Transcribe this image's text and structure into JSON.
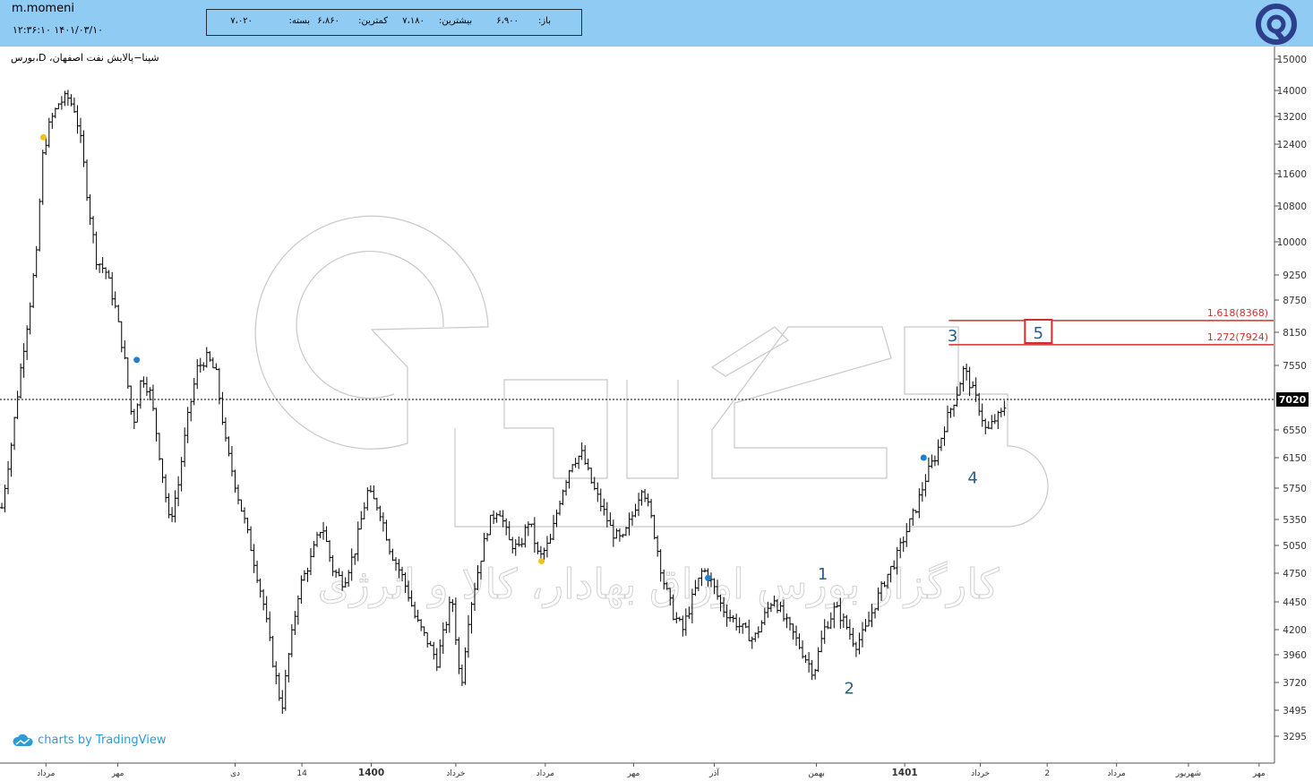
{
  "header": {
    "username": "m.momeni",
    "datetime": "۱۴۰۱/۰۳/۱۰ ۱۲:۳۶:۱۰",
    "quote": {
      "open_label": "باز:",
      "open_value": "۶،۹۰۰",
      "high_label": "بیشترین:",
      "high_value": "۷،۱۸۰",
      "low_label": "کمترین:",
      "low_value": "۶،۸۶۰",
      "close_label": "بسته:",
      "close_value": "۷،۰۲۰"
    },
    "logo_icon": "broker-logo-icon"
  },
  "chart_title": "بورس،D ،شپنا−پالایش نفت اصفهان",
  "watermark_text": "کارگزار بورس اوراق بهادار، کالا و انرژی",
  "attribution": "charts by TradingView",
  "colors": {
    "header": "#90cbf4",
    "bars": "#000000",
    "fib_line": "#d32f2f",
    "wave_label": "#2a5d8c",
    "marker_yellow": "#f2c21b",
    "marker_blue": "#1f7fd1"
  },
  "chart_data": {
    "type": "ohlc",
    "ylim": [
      3100,
      15600
    ],
    "y_ticks": [
      15000,
      14000,
      13200,
      12400,
      11600,
      10800,
      10000,
      9250,
      8750,
      8150,
      7550,
      6550,
      6150,
      5750,
      5350,
      5050,
      4750,
      4450,
      4200,
      3960,
      3720,
      3495,
      3295
    ],
    "last_price": 7020,
    "last_price_label": "7020",
    "x_ticks": [
      {
        "label": "مرداد",
        "pos": 0.035
      },
      {
        "label": "مهر",
        "pos": 0.092
      },
      {
        "label": "دی",
        "pos": 0.185
      },
      {
        "label": "14",
        "pos": 0.238
      },
      {
        "label": "1400",
        "pos": 0.293
      },
      {
        "label": "خرداد",
        "pos": 0.36
      },
      {
        "label": "مرداد",
        "pos": 0.431
      },
      {
        "label": "مهر",
        "pos": 0.501
      },
      {
        "label": "آذر",
        "pos": 0.565
      },
      {
        "label": "بهمن",
        "pos": 0.646
      },
      {
        "label": "1401",
        "pos": 0.716
      },
      {
        "label": "خرداد",
        "pos": 0.776
      },
      {
        "label": "2",
        "pos": 0.829
      },
      {
        "label": "مرداد",
        "pos": 0.884
      },
      {
        "label": "شهریور",
        "pos": 0.941
      },
      {
        "label": "مهر",
        "pos": 0.997
      }
    ],
    "price_path": [
      [
        0.0,
        5500
      ],
      [
        0.008,
        6400
      ],
      [
        0.015,
        7500
      ],
      [
        0.022,
        8600
      ],
      [
        0.028,
        9800
      ],
      [
        0.032,
        12000
      ],
      [
        0.038,
        13000
      ],
      [
        0.045,
        13600
      ],
      [
        0.052,
        13800
      ],
      [
        0.058,
        13400
      ],
      [
        0.063,
        12400
      ],
      [
        0.068,
        11000
      ],
      [
        0.075,
        9600
      ],
      [
        0.083,
        9300
      ],
      [
        0.09,
        8600
      ],
      [
        0.097,
        7700
      ],
      [
        0.104,
        6600
      ],
      [
        0.111,
        7400
      ],
      [
        0.118,
        7100
      ],
      [
        0.125,
        6200
      ],
      [
        0.133,
        5300
      ],
      [
        0.14,
        5800
      ],
      [
        0.148,
        6800
      ],
      [
        0.155,
        7500
      ],
      [
        0.163,
        7700
      ],
      [
        0.17,
        7400
      ],
      [
        0.178,
        6300
      ],
      [
        0.188,
        5600
      ],
      [
        0.198,
        5000
      ],
      [
        0.208,
        4400
      ],
      [
        0.215,
        3900
      ],
      [
        0.222,
        3500
      ],
      [
        0.228,
        4000
      ],
      [
        0.236,
        4600
      ],
      [
        0.245,
        4900
      ],
      [
        0.254,
        5300
      ],
      [
        0.262,
        4800
      ],
      [
        0.271,
        4650
      ],
      [
        0.28,
        5000
      ],
      [
        0.29,
        5700
      ],
      [
        0.299,
        5500
      ],
      [
        0.308,
        5000
      ],
      [
        0.318,
        4700
      ],
      [
        0.328,
        4300
      ],
      [
        0.337,
        4100
      ],
      [
        0.345,
        3900
      ],
      [
        0.351,
        4200
      ],
      [
        0.357,
        4500
      ],
      [
        0.364,
        3650
      ],
      [
        0.37,
        4300
      ],
      [
        0.378,
        4800
      ],
      [
        0.386,
        5300
      ],
      [
        0.394,
        5500
      ],
      [
        0.402,
        5100
      ],
      [
        0.41,
        5000
      ],
      [
        0.418,
        5350
      ],
      [
        0.426,
        4900
      ],
      [
        0.435,
        5100
      ],
      [
        0.444,
        5700
      ],
      [
        0.452,
        6100
      ],
      [
        0.46,
        6200
      ],
      [
        0.468,
        5800
      ],
      [
        0.476,
        5500
      ],
      [
        0.484,
        5200
      ],
      [
        0.492,
        5100
      ],
      [
        0.5,
        5400
      ],
      [
        0.508,
        5800
      ],
      [
        0.516,
        5300
      ],
      [
        0.524,
        4700
      ],
      [
        0.532,
        4350
      ],
      [
        0.54,
        4200
      ],
      [
        0.548,
        4500
      ],
      [
        0.556,
        4800
      ],
      [
        0.563,
        4650
      ],
      [
        0.571,
        4400
      ],
      [
        0.579,
        4300
      ],
      [
        0.588,
        4200
      ],
      [
        0.596,
        4100
      ],
      [
        0.604,
        4300
      ],
      [
        0.612,
        4500
      ],
      [
        0.62,
        4300
      ],
      [
        0.628,
        4150
      ],
      [
        0.636,
        3960
      ],
      [
        0.644,
        3800
      ],
      [
        0.652,
        4200
      ],
      [
        0.661,
        4400
      ],
      [
        0.669,
        4250
      ],
      [
        0.677,
        4050
      ],
      [
        0.685,
        4200
      ],
      [
        0.693,
        4450
      ],
      [
        0.701,
        4700
      ],
      [
        0.709,
        4900
      ],
      [
        0.717,
        5200
      ],
      [
        0.725,
        5500
      ],
      [
        0.733,
        5900
      ],
      [
        0.741,
        6200
      ],
      [
        0.749,
        6700
      ],
      [
        0.757,
        7100
      ],
      [
        0.763,
        7500
      ],
      [
        0.769,
        7200
      ],
      [
        0.775,
        6900
      ],
      [
        0.781,
        6500
      ],
      [
        0.787,
        6700
      ],
      [
        0.793,
        6800
      ],
      [
        0.797,
        7020
      ]
    ],
    "fib_levels": [
      {
        "label": "1.618(8368)",
        "value": 8368
      },
      {
        "label": "1.272(7924)",
        "value": 7924
      }
    ],
    "fib_x_start": 0.751,
    "wave_labels": [
      {
        "label": "1",
        "x": 0.651,
        "y": 4750
      },
      {
        "label": "2",
        "x": 0.672,
        "y": 3680
      },
      {
        "label": "3",
        "x": 0.754,
        "y": 8100
      },
      {
        "label": "4",
        "x": 0.77,
        "y": 5900
      },
      {
        "label": "5",
        "x": 0.822,
        "y": 8150
      }
    ],
    "markers": [
      {
        "color": "yellow",
        "x": 0.033,
        "y": 12600
      },
      {
        "color": "blue",
        "x": 0.107,
        "y": 7650
      },
      {
        "color": "yellow",
        "x": 0.428,
        "y": 4880
      },
      {
        "color": "blue",
        "x": 0.56,
        "y": 4700
      },
      {
        "color": "blue",
        "x": 0.731,
        "y": 6150
      }
    ]
  }
}
